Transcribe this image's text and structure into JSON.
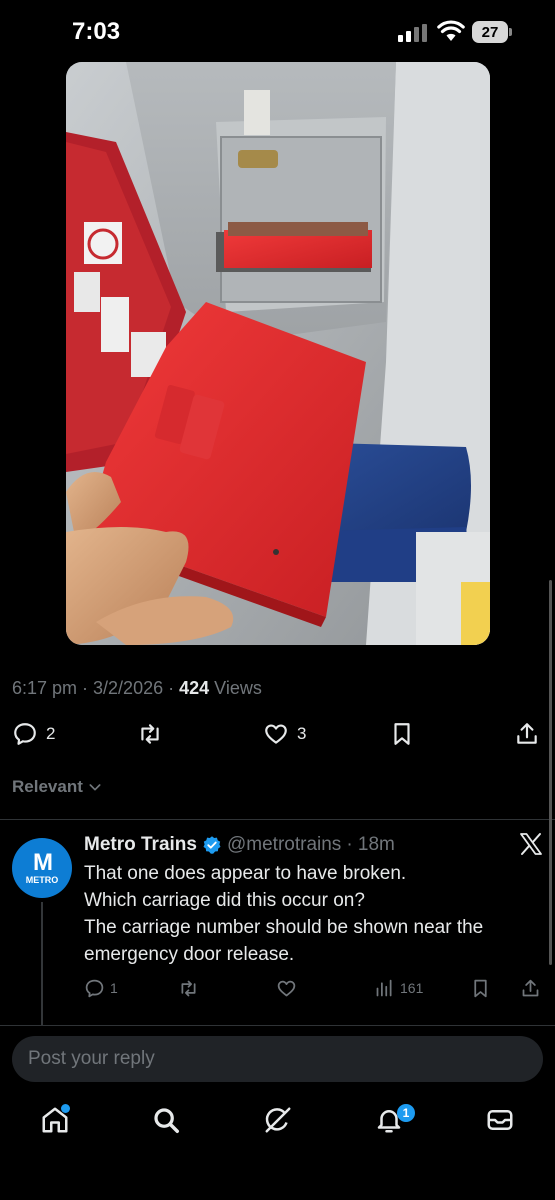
{
  "status_bar": {
    "time": "7:03",
    "battery": "27"
  },
  "post": {
    "timestamp": "6:17 pm · 3/2/2026 · ",
    "views_count": "424",
    "views_label": " Views",
    "actions": {
      "replies": "2",
      "likes": "3"
    }
  },
  "sort": {
    "label": "Relevant"
  },
  "reply": {
    "avatar_text": "METRO",
    "avatar_mark": "M",
    "name": "Metro Trains",
    "handle": "@metrotrains",
    "time": "· 18m",
    "text_lines": [
      "That one does appear to have broken.",
      "Which carriage did this occur on?",
      "The carriage number should be shown near the emergency door release."
    ],
    "actions": {
      "replies": "1",
      "views": "161"
    }
  },
  "composer": {
    "placeholder": "Post your reply"
  },
  "nav": {
    "notifications_badge": "1"
  },
  "colors": {
    "accent": "#1d9bf0",
    "background": "#000000",
    "secondary_text": "#71767b",
    "metro_blue": "#0d7dd4",
    "panel_red": "#e0262e"
  },
  "icons": {
    "status": [
      "signal-icon",
      "wifi-icon",
      "battery-icon"
    ],
    "post_actions": [
      "reply-icon",
      "repost-icon",
      "like-icon",
      "bookmark-icon",
      "share-icon"
    ],
    "nav": [
      "home-icon",
      "search-icon",
      "grok-icon",
      "notifications-icon",
      "messages-icon"
    ]
  }
}
